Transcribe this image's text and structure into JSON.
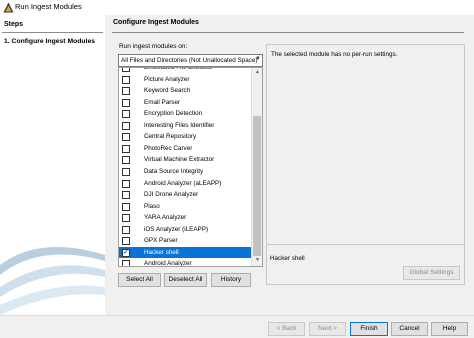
{
  "window": {
    "title": "Run Ingest Modules"
  },
  "steps": {
    "header": "Steps",
    "items": [
      {
        "label": "1.   Configure Ingest Modules"
      }
    ]
  },
  "main": {
    "header": "Configure Ingest Modules",
    "run_label": "Run ingest modules on:",
    "dropdown_value": "All Files and Directories (Not Unallocated Space)",
    "modules": [
      {
        "label": "Embedded File Extractor",
        "checked": false
      },
      {
        "label": "Picture Analyzer",
        "checked": false
      },
      {
        "label": "Keyword Search",
        "checked": false
      },
      {
        "label": "Email Parser",
        "checked": false
      },
      {
        "label": "Encryption Detection",
        "checked": false
      },
      {
        "label": "Interesting Files Identifier",
        "checked": false
      },
      {
        "label": "Central Repository",
        "checked": false
      },
      {
        "label": "PhotoRec Carver",
        "checked": false
      },
      {
        "label": "Virtual Machine Extractor",
        "checked": false
      },
      {
        "label": "Data Source Integrity",
        "checked": false
      },
      {
        "label": "Android Analyzer (aLEAPP)",
        "checked": false
      },
      {
        "label": "DJI Drone Analyzer",
        "checked": false
      },
      {
        "label": "Plaso",
        "checked": false
      },
      {
        "label": "YARA Analyzer",
        "checked": false
      },
      {
        "label": "iOS Analyzer (iLEAPP)",
        "checked": false
      },
      {
        "label": "GPX Parser",
        "checked": false
      },
      {
        "label": "Hacker shell",
        "checked": true,
        "selected": true
      },
      {
        "label": "Android Analyzer",
        "checked": false
      }
    ],
    "buttons": {
      "select_all": "Select All",
      "deselect_all": "Deselect All",
      "history": "History"
    }
  },
  "settings": {
    "message": "The selected module has no per-run settings.",
    "module_name": "Hacker shell",
    "global_settings": "Global Settings"
  },
  "nav": {
    "back": "< Back",
    "next": "Next >",
    "finish": "Finish",
    "cancel": "Cancel",
    "help": "Help"
  },
  "colors": {
    "selection": "#0a73d6"
  }
}
